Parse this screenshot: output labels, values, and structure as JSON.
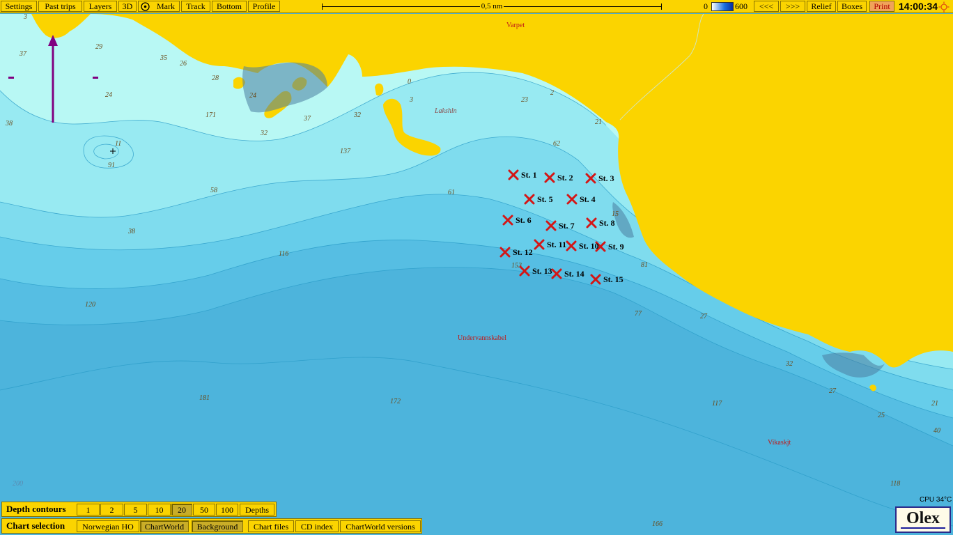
{
  "toolbar": {
    "left_buttons": [
      "Settings",
      "Past trips",
      "Layers",
      "3D",
      "Mark",
      "Track",
      "Bottom",
      "Profile"
    ],
    "scale_label": "0,5 nm",
    "depth_min": "0",
    "depth_max": "600",
    "right_buttons": [
      "<<<",
      ">>>",
      "Relief",
      "Boxes",
      "Print"
    ],
    "clock": "14:00:34"
  },
  "map": {
    "colors": {
      "land": "#fbd400",
      "shallow": "#b8f8f4",
      "deep": "#4db4dc",
      "marker": "#d41616"
    },
    "places": [
      "Varpet",
      "Lakshln",
      "Undervannskabel",
      "Vikaskjt"
    ],
    "depth_soundings": [
      "3",
      "37",
      "29",
      "35",
      "26",
      "24",
      "24",
      "28",
      "171",
      "32",
      "37",
      "38",
      "32",
      "137",
      "0",
      "3",
      "2",
      "23",
      "21",
      "62",
      "61",
      "58",
      "38",
      "116",
      "120",
      "181",
      "172",
      "200",
      "166",
      "77",
      "27",
      "32",
      "27",
      "117",
      "25",
      "21",
      "40",
      "118",
      "15",
      "81",
      "153",
      "11",
      "91"
    ],
    "stations": [
      "St. 1",
      "St. 2",
      "St. 3",
      "St. 4",
      "St. 5",
      "St. 6",
      "St. 7",
      "St. 8",
      "St. 9",
      "St. 10",
      "St. 11",
      "St. 12",
      "St. 13",
      "St. 14",
      "St. 15"
    ]
  },
  "depth_contours": {
    "title": "Depth contours",
    "options": [
      "1",
      "2",
      "5",
      "10",
      "20",
      "50",
      "100",
      "Depths"
    ],
    "selected": "20"
  },
  "chart_selection": {
    "title": "Chart selection",
    "options": [
      "Norwegian HO",
      "ChartWorld",
      "Background",
      "Chart files",
      "CD index",
      "ChartWorld versions"
    ],
    "active": [
      "ChartWorld",
      "Background"
    ]
  },
  "status": {
    "cpu": "CPU 34°C",
    "brand": "Olex"
  }
}
